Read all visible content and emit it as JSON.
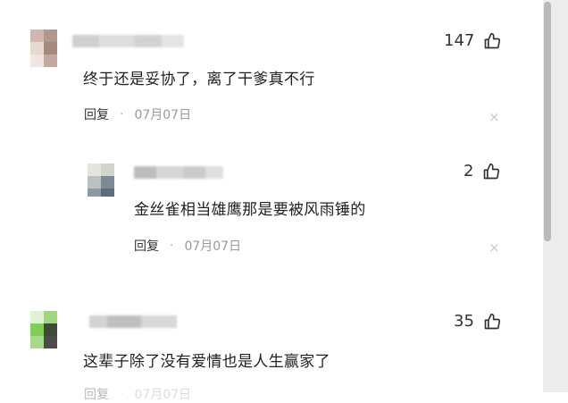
{
  "comments": [
    {
      "text": "终于还是妥协了，离了干爹真不行",
      "likes": "147",
      "reply_label": "回复",
      "separator": "·",
      "date": "07月07日",
      "close": "×"
    },
    {
      "text": "金丝雀相当雄鹰那是要被风雨锤的",
      "likes": "2",
      "reply_label": "回复",
      "separator": "·",
      "date": "07月07日",
      "close": "×"
    },
    {
      "text": "这辈子除了没有爱情也是人生赢家了",
      "likes": "35",
      "reply_label": "回复",
      "separator": "·",
      "date": "07月07日"
    }
  ],
  "icons": {
    "like": "thumbs-up-icon",
    "close": "close-icon"
  },
  "colors": {
    "date": "#9a9a9a",
    "scroll_thumb": "#b9b9b9",
    "scroll_track": "#ececec"
  }
}
